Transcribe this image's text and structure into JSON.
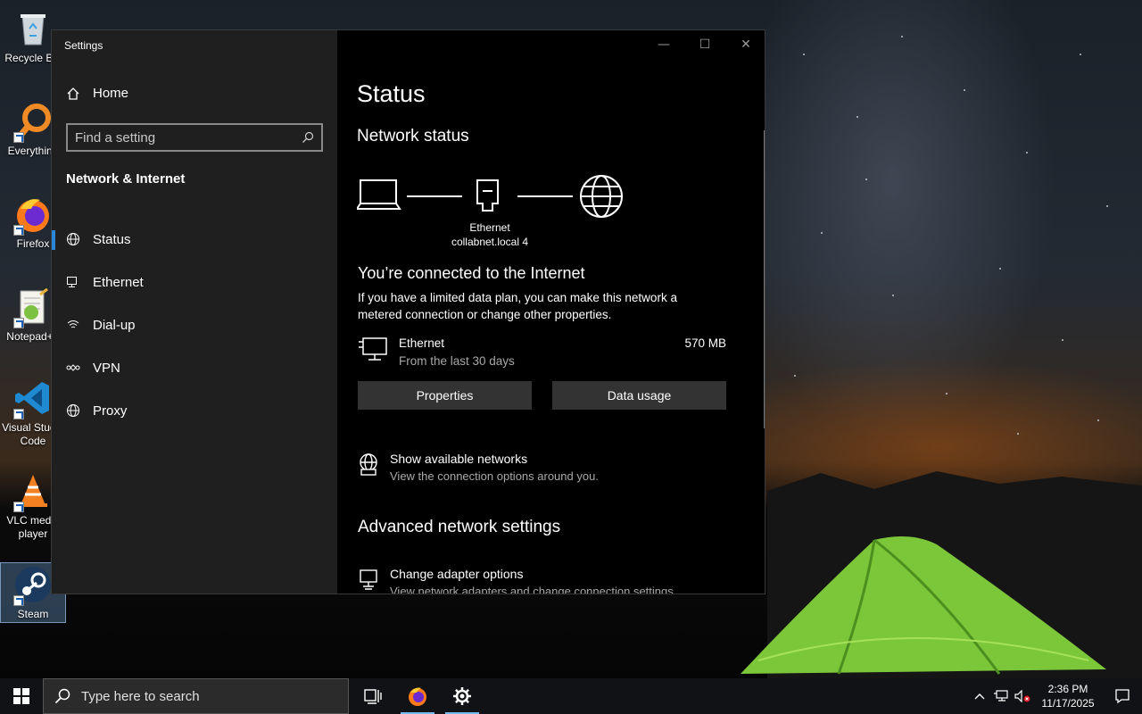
{
  "desktop": {
    "icons": [
      {
        "label": "Recycle Bin",
        "icon": "recycle-bin-icon"
      },
      {
        "label": "Everything",
        "icon": "everything-search-icon"
      },
      {
        "label": "Firefox",
        "icon": "firefox-icon"
      },
      {
        "label": "Notepad++",
        "icon": "notepad-plus-plus-icon"
      },
      {
        "label": "Visual Studio Code",
        "icon": "vscode-icon"
      },
      {
        "label": "VLC media player",
        "icon": "vlc-icon"
      },
      {
        "label": "Steam",
        "icon": "steam-icon"
      }
    ]
  },
  "window": {
    "title": "Settings",
    "controls": {
      "minimize": "—",
      "maximize": "☐",
      "close": "✕"
    }
  },
  "sidebar": {
    "home_label": "Home",
    "search_placeholder": "Find a setting",
    "section_title": "Network & Internet",
    "items": [
      {
        "label": "Status",
        "icon": "status-globe-icon",
        "active": true
      },
      {
        "label": "Ethernet",
        "icon": "ethernet-icon"
      },
      {
        "label": "Dial-up",
        "icon": "dial-up-icon"
      },
      {
        "label": "VPN",
        "icon": "vpn-icon"
      },
      {
        "label": "Proxy",
        "icon": "proxy-globe-icon"
      }
    ]
  },
  "main": {
    "page_title": "Status",
    "network_status_heading": "Network status",
    "diagram": {
      "adapter_name": "Ethernet",
      "network_name": "collabnet.local 4"
    },
    "connected_title": "You’re connected to the Internet",
    "connected_desc": "If you have a limited data plan, you can make this network a metered connection or change other properties.",
    "connection": {
      "name": "Ethernet",
      "period": "From the last 30 days",
      "usage": "570 MB"
    },
    "buttons": {
      "properties": "Properties",
      "data_usage": "Data usage"
    },
    "show_networks": {
      "title": "Show available networks",
      "desc": "View the connection options around you."
    },
    "advanced_heading": "Advanced network settings",
    "adapter_options": {
      "title": "Change adapter options",
      "desc": "View network adapters and change connection settings."
    }
  },
  "taskbar": {
    "search_placeholder": "Type here to search",
    "time": "2:36 PM",
    "date": "11/17/2025"
  },
  "colors": {
    "accent": "#2b88d8",
    "window_bg": "#000000",
    "sidebar_bg": "#1f1f1f",
    "button_bg": "#333333"
  }
}
